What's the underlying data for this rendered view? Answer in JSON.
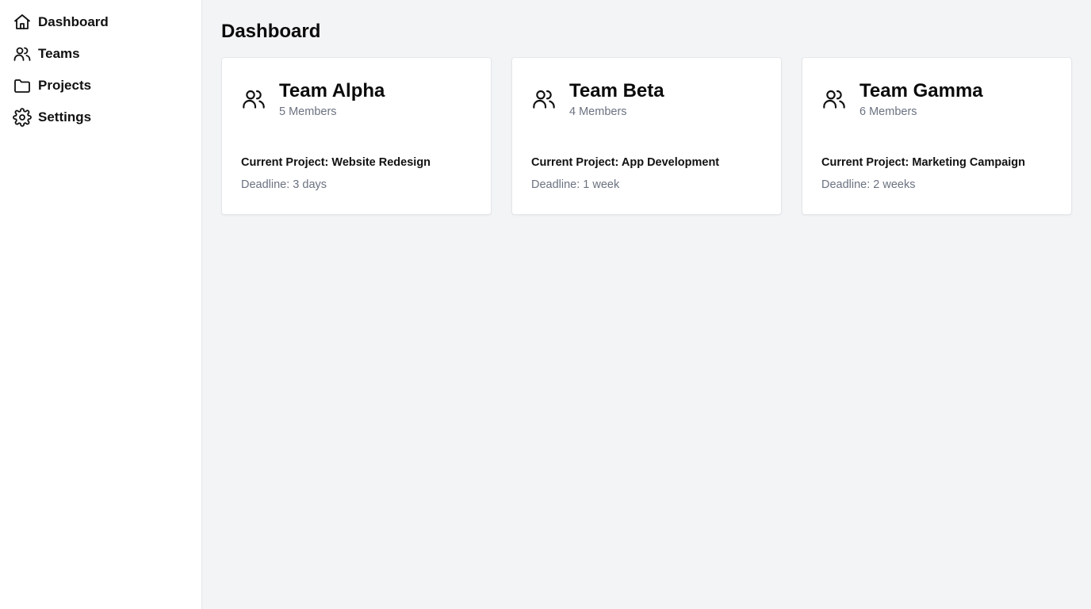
{
  "sidebar": {
    "items": [
      {
        "label": "Dashboard",
        "icon": "home-icon"
      },
      {
        "label": "Teams",
        "icon": "users-icon"
      },
      {
        "label": "Projects",
        "icon": "folder-icon"
      },
      {
        "label": "Settings",
        "icon": "gear-icon"
      }
    ]
  },
  "main": {
    "title": "Dashboard",
    "cards": [
      {
        "name": "Team Alpha",
        "members": "5 Members",
        "project": "Current Project: Website Redesign",
        "deadline": "Deadline: 3 days",
        "icon": "users-icon"
      },
      {
        "name": "Team Beta",
        "members": "4 Members",
        "project": "Current Project: App Development",
        "deadline": "Deadline: 1 week",
        "icon": "users-icon"
      },
      {
        "name": "Team Gamma",
        "members": "6 Members",
        "project": "Current Project: Marketing Campaign",
        "deadline": "Deadline: 2 weeks",
        "icon": "users-icon"
      }
    ]
  },
  "colors": {
    "sidebar_bg": "#ffffff",
    "main_bg": "#f3f4f6",
    "card_bg": "#ffffff",
    "muted_text": "#6b7280"
  }
}
